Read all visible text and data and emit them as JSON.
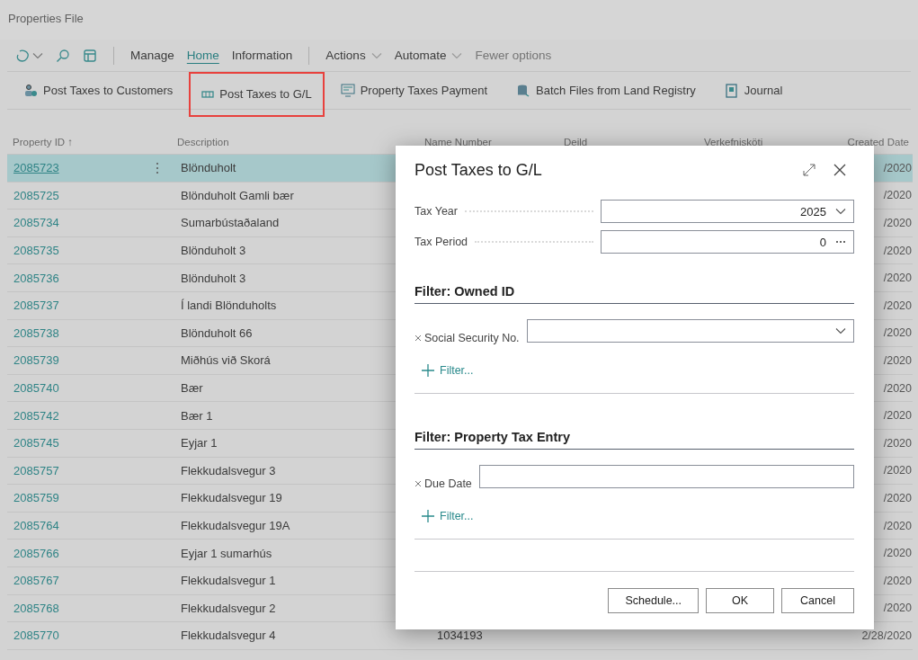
{
  "page": {
    "title": "Properties File"
  },
  "nav": {
    "tabs": [
      {
        "label": "Manage",
        "selected": false
      },
      {
        "label": "Home",
        "selected": true
      },
      {
        "label": "Information",
        "selected": false
      }
    ],
    "menus": [
      {
        "label": "Actions"
      },
      {
        "label": "Automate"
      }
    ],
    "fewer_options": "Fewer options"
  },
  "actions": [
    {
      "label": "Post Taxes to Customers",
      "highlighted": false
    },
    {
      "label": "Post Taxes to G/L",
      "highlighted": true
    },
    {
      "label": "Property Taxes Payment",
      "highlighted": false
    },
    {
      "label": "Batch Files from Land Registry",
      "highlighted": false
    },
    {
      "label": "Journal",
      "highlighted": false
    }
  ],
  "table": {
    "columns": [
      {
        "label": "Property ID",
        "sort_indicator": "↑"
      },
      {
        "label": "Description"
      },
      {
        "label": "Name Number"
      },
      {
        "label": "Deild"
      },
      {
        "label": "Verkefnisköti"
      },
      {
        "label": "Created Date"
      }
    ],
    "rows": [
      {
        "property_id": "2085723",
        "description": "Blönduholt",
        "created_date": "/2020",
        "selected": true
      },
      {
        "property_id": "2085725",
        "description": "Blönduholt Gamli bær",
        "created_date": "/2020",
        "selected": false
      },
      {
        "property_id": "2085734",
        "description": "Sumarbústaðaland",
        "created_date": "/2020",
        "selected": false
      },
      {
        "property_id": "2085735",
        "description": "Blönduholt 3",
        "created_date": "/2020",
        "selected": false
      },
      {
        "property_id": "2085736",
        "description": "Blönduholt 3",
        "created_date": "/2020",
        "selected": false
      },
      {
        "property_id": "2085737",
        "description": "Í landi Blönduholts",
        "created_date": "/2020",
        "selected": false
      },
      {
        "property_id": "2085738",
        "description": "Blönduholt 66",
        "created_date": "/2020",
        "selected": false
      },
      {
        "property_id": "2085739",
        "description": "Miðhús við Skorá",
        "created_date": "/2020",
        "selected": false
      },
      {
        "property_id": "2085740",
        "description": "Bær",
        "created_date": "/2020",
        "selected": false
      },
      {
        "property_id": "2085742",
        "description": "Bær 1",
        "created_date": "/2020",
        "selected": false
      },
      {
        "property_id": "2085745",
        "description": "Eyjar 1",
        "created_date": "/2020",
        "selected": false
      },
      {
        "property_id": "2085757",
        "description": "Flekkudalsvegur 3",
        "created_date": "/2020",
        "selected": false
      },
      {
        "property_id": "2085759",
        "description": "Flekkudalsvegur 19",
        "created_date": "/2020",
        "selected": false
      },
      {
        "property_id": "2085764",
        "description": "Flekkudalsvegur 19A",
        "created_date": "/2020",
        "selected": false
      },
      {
        "property_id": "2085766",
        "description": "Eyjar 1 sumarhús",
        "created_date": "/2020",
        "selected": false
      },
      {
        "property_id": "2085767",
        "description": "Flekkudalsvegur 1",
        "created_date": "/2020",
        "selected": false
      },
      {
        "property_id": "2085768",
        "description": "Flekkudalsvegur 2",
        "created_date": "/2020",
        "selected": false
      },
      {
        "property_id": "2085770",
        "description": "Flekkudalsvegur 4",
        "name_number": "1034193",
        "created_date": "2/28/2020",
        "selected": false
      }
    ]
  },
  "dialog": {
    "title": "Post Taxes to G/L",
    "fields": [
      {
        "label": "Tax Year",
        "value": "2025",
        "kind": "dropdown"
      },
      {
        "label": "Tax Period",
        "value": "0",
        "kind": "lookup"
      }
    ],
    "sections": [
      {
        "title": "Filter: Owned ID",
        "filters": [
          {
            "label": "Social Security No.",
            "kind": "dropdown"
          }
        ],
        "add_filter": "Filter..."
      },
      {
        "title": "Filter: Property Tax Entry",
        "filters": [
          {
            "label": "Due Date",
            "kind": "text"
          }
        ],
        "add_filter": "Filter..."
      }
    ],
    "buttons": [
      "Schedule...",
      "OK",
      "Cancel"
    ]
  }
}
